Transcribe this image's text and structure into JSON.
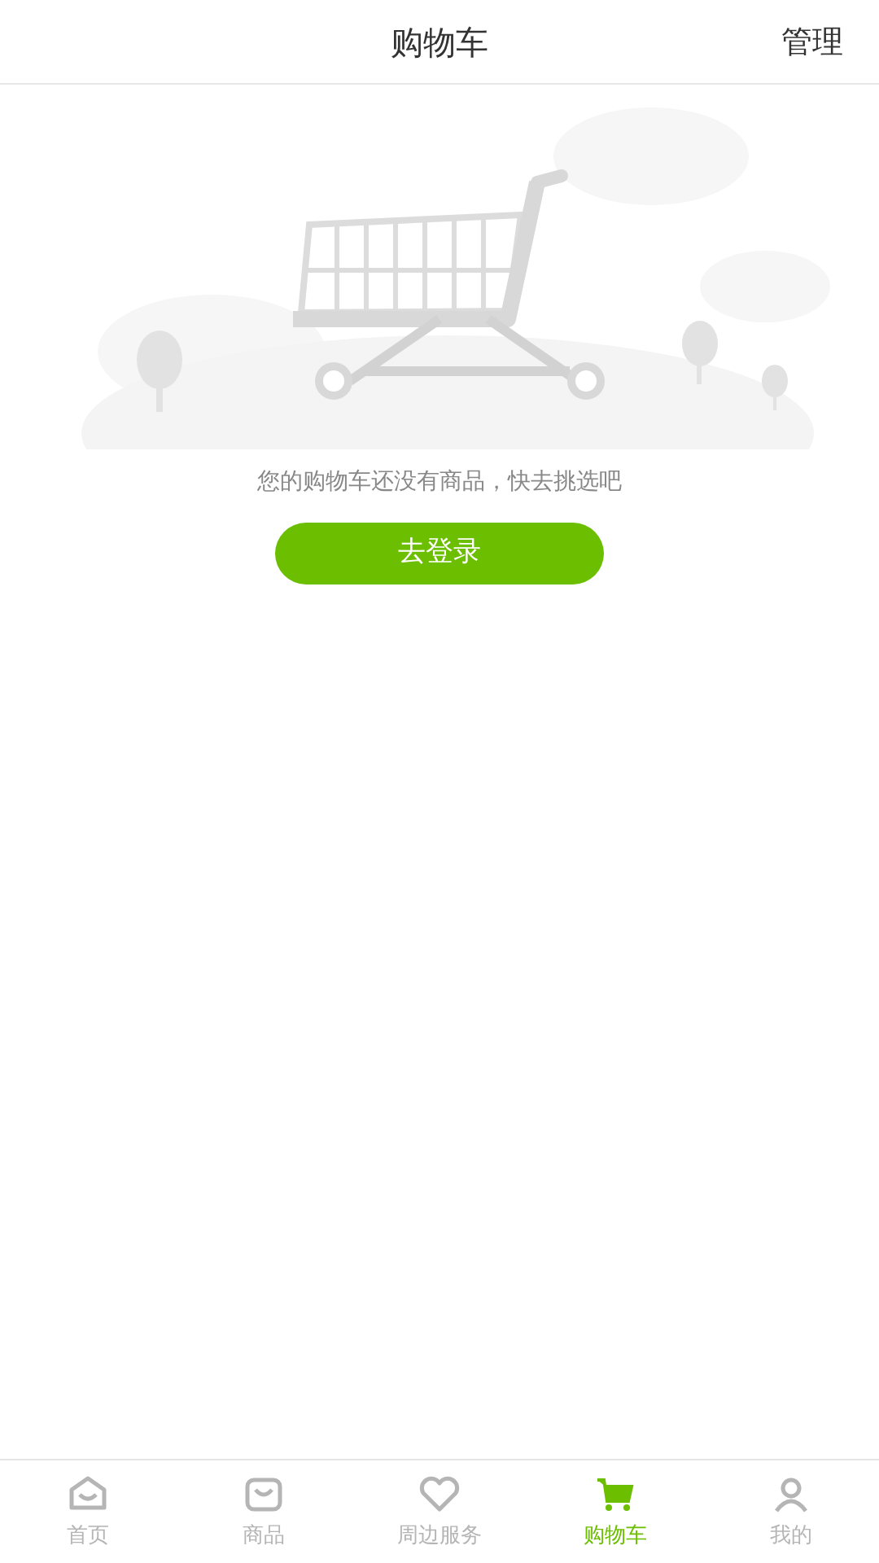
{
  "header": {
    "title": "购物车",
    "action": "管理"
  },
  "empty_state": {
    "message": "您的购物车还没有商品，快去挑选吧",
    "button": "去登录"
  },
  "tab_bar": [
    {
      "label": "首页",
      "kind": "home",
      "selected": false
    },
    {
      "label": "商品",
      "kind": "bag",
      "selected": false
    },
    {
      "label": "周边服务",
      "kind": "heart",
      "selected": false
    },
    {
      "label": "购物车",
      "kind": "cart",
      "selected": true
    },
    {
      "label": "我的",
      "kind": "user",
      "selected": false
    }
  ]
}
